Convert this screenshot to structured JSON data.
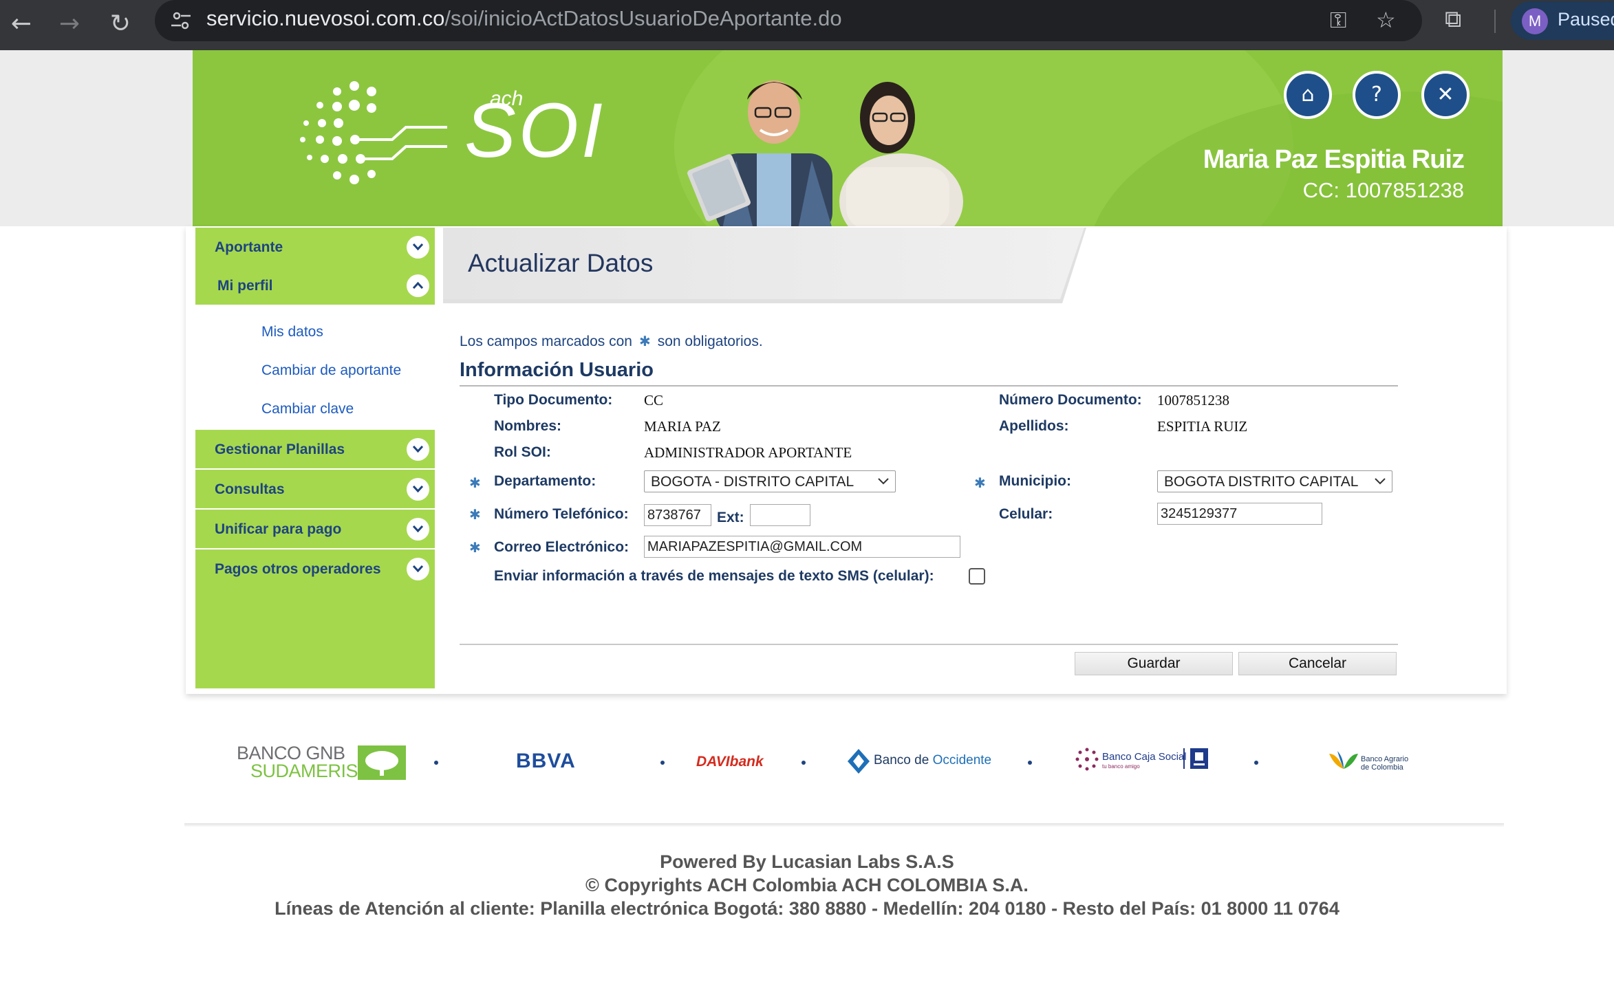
{
  "browser": {
    "url_host": "servicio.nuevosoi.com.co",
    "url_path": "/soi/inicioActDatosUsuarioDeAportante.do",
    "profile_initial": "M",
    "profile_label": "Paused"
  },
  "header": {
    "brand_small": "ach",
    "brand_big": "SOI",
    "user_name": "Maria Paz Espitia Ruiz",
    "user_id": "CC: 1007851238",
    "colors": {
      "banner": "#8cc63f",
      "header_button": "#1e4f8a"
    }
  },
  "sidebar": {
    "items": [
      {
        "label": "Aportante",
        "expanded": false
      },
      {
        "label": "Mi perfil",
        "expanded": true
      },
      {
        "label": "Gestionar Planillas",
        "expanded": false
      },
      {
        "label": "Consultas",
        "expanded": false
      },
      {
        "label": "Unificar para pago",
        "expanded": false
      },
      {
        "label": "Pagos otros operadores",
        "expanded": false
      }
    ],
    "sub_items": [
      "Mis datos",
      "Cambiar de aportante",
      "Cambiar clave"
    ],
    "colors": {
      "item_bg": "#a6d84e",
      "item_text": "#1e4480",
      "link": "#1d5bbf"
    }
  },
  "main": {
    "title": "Actualizar Datos",
    "required_note_before": "Los campos marcados con",
    "required_note_after": "son obligatorios.",
    "required_marker": "✱",
    "section_title": "Información Usuario",
    "fields": {
      "tipo_documento": {
        "label": "Tipo Documento:",
        "value": "CC"
      },
      "numero_documento": {
        "label": "Número Documento:",
        "value": "1007851238"
      },
      "nombres": {
        "label": "Nombres:",
        "value": "MARIA PAZ"
      },
      "apellidos": {
        "label": "Apellidos:",
        "value": "ESPITIA RUIZ"
      },
      "rol_soi": {
        "label": "Rol SOI:",
        "value": "ADMINISTRADOR APORTANTE"
      },
      "departamento": {
        "label": "Departamento:",
        "value": "BOGOTA - DISTRITO CAPITAL"
      },
      "municipio": {
        "label": "Municipio:",
        "value": "BOGOTA DISTRITO CAPITAL"
      },
      "telefono": {
        "label": "Número Telefónico:",
        "value": "8738767"
      },
      "ext": {
        "label": "Ext:",
        "value": ""
      },
      "celular": {
        "label": "Celular:",
        "value": "3245129377"
      },
      "correo": {
        "label": "Correo Electrónico:",
        "value": "MARIAPAZESPITIA@GMAIL.COM"
      },
      "sms": {
        "label": "Enviar información a través de mensajes de texto SMS (celular):",
        "checked": false
      }
    },
    "buttons": {
      "save": "Guardar",
      "cancel": "Cancelar"
    }
  },
  "banks": {
    "gnb_line1": "BANCO GNB",
    "gnb_line2": "SUDAMERIS",
    "bbva": "BBVA",
    "davi": "DAVIbank",
    "occidente_a": "Banco de ",
    "occidente_b": "Occidente",
    "cajasocial": "Banco Caja Social",
    "cajasocial_tag": "tu banco amigo",
    "agrario_1": "Banco Agrario",
    "agrario_2": "de Colombia"
  },
  "footer": {
    "powered": "Powered By Lucasian Labs S.A.S",
    "copyright": "© Copyrights ACH Colombia ACH COLOMBIA S.A.",
    "lines": "Líneas de Atención al cliente: Planilla electrónica Bogotá: 380 8880 - Medellín: 204 0180 - Resto del País: 01 8000 11 0764"
  }
}
